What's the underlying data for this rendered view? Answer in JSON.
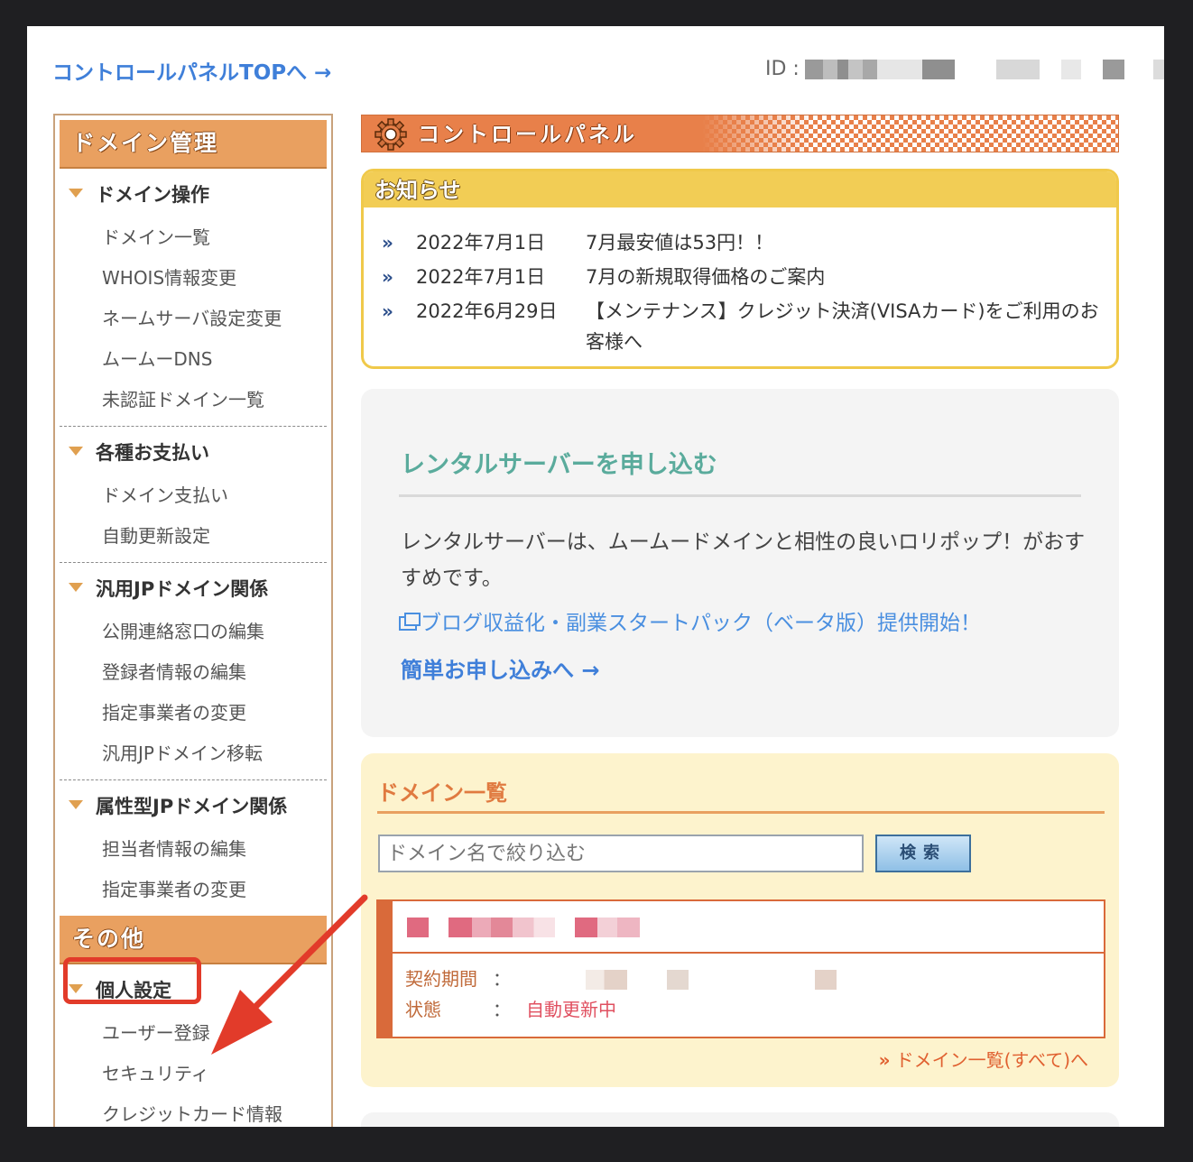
{
  "top": {
    "control_panel_top_link": "コントロールパネルTOPへ",
    "control_panel_top_arrow": "→",
    "id_label": "ID :"
  },
  "sidebar": {
    "section1_title": "ドメイン管理",
    "groups": [
      {
        "title": "ドメイン操作",
        "items": [
          "ドメイン一覧",
          "WHOIS情報変更",
          "ネームサーバ設定変更",
          "ムームーDNS",
          "未認証ドメイン一覧"
        ]
      },
      {
        "title": "各種お支払い",
        "items": [
          "ドメイン支払い",
          "自動更新設定"
        ]
      },
      {
        "title": "汎用JPドメイン関係",
        "items": [
          "公開連絡窓口の編集",
          "登録者情報の編集",
          "指定事業者の変更",
          "汎用JPドメイン移転"
        ]
      },
      {
        "title": "属性型JPドメイン関係",
        "items": [
          "担当者情報の編集",
          "指定事業者の変更"
        ]
      }
    ],
    "section2_title": "その他",
    "personal_group": {
      "title": "個人設定",
      "items": [
        "ユーザー登録",
        "セキュリティ",
        "クレジットカード情報"
      ]
    }
  },
  "control_panel": {
    "title": "コントロールパネル"
  },
  "notice": {
    "title": "お知らせ",
    "items": [
      {
        "date": "2022年7月1日",
        "text": "7月最安値は53円！！"
      },
      {
        "date": "2022年7月1日",
        "text": "7月の新規取得価格のご案内"
      },
      {
        "date": "2022年6月29日",
        "text": "【メンテナンス】クレジット決済(VISAカード)をご利用のお客様へ"
      }
    ]
  },
  "rental": {
    "title": "レンタルサーバーを申し込む",
    "description": "レンタルサーバーは、ムームードメインと相性の良いロリポップ！がおすすめです。",
    "link": "ブログ収益化・副業スタートパック（ベータ版）提供開始！",
    "apply": "簡単お申し込みへ →"
  },
  "domain_list": {
    "title": "ドメイン一覧",
    "search_placeholder": "ドメイン名で絞り込む",
    "search_button": "検索",
    "contract_label": "契約期間",
    "status_label": "状態",
    "colon": "：",
    "status_value": "自動更新中",
    "all_link": "ドメイン一覧(すべて)へ",
    "all_link_bullet": "»"
  },
  "colors": {
    "accent_orange": "#e9a060",
    "link_blue": "#3f7fd9",
    "notice_yellow": "#f2cd55",
    "rental_green": "#5aab9c",
    "highlight_red": "#e23b2a"
  }
}
